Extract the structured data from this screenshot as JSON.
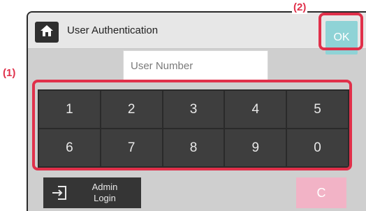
{
  "header": {
    "title": "User Authentication",
    "home_icon": "home-icon",
    "ok_label": "OK"
  },
  "user_field": {
    "placeholder": "User Number",
    "value": ""
  },
  "keypad": {
    "keys": [
      "1",
      "2",
      "3",
      "4",
      "5",
      "6",
      "7",
      "8",
      "9",
      "0"
    ]
  },
  "footer": {
    "admin_login_label_line1": "Admin",
    "admin_login_label_line2": "Login",
    "admin_login_icon": "login-icon",
    "clear_label": "C"
  },
  "callouts": {
    "keypad_label": "(1)",
    "ok_label": "(2)"
  },
  "colors": {
    "callout": "#e0304a",
    "ok_button": "#8fd3d6",
    "clear_button": "#f2b3c6",
    "key_bg": "#3e3e3e"
  }
}
